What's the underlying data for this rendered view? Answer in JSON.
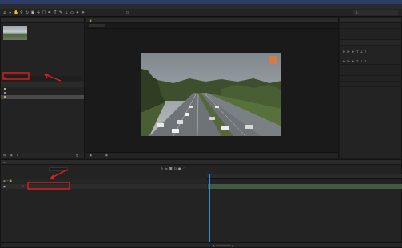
{
  "app": {
    "title": "",
    "menu": [
      "",
      "",
      "",
      "",
      "",
      "",
      "",
      "",
      ""
    ]
  },
  "toolbar": {
    "snapping_label": "",
    "search_label": "",
    "workspaces": [
      "",
      "",
      "",
      "",
      "",
      ""
    ]
  },
  "project": {
    "tab_label": "",
    "comp_tab_label": "",
    "thumb_name": "",
    "thumb_info": [
      "",
      ""
    ],
    "items": [
      "",
      "",
      ""
    ]
  },
  "viewer": {
    "tab_label": "",
    "zoom": "",
    "timecode": "",
    "quality": "",
    "camera": "",
    "views": ""
  },
  "right_panel": {
    "items": [
      "",
      "",
      "",
      "",
      "",
      "",
      "",
      "",
      "",
      "",
      "",
      ""
    ]
  },
  "timeline": {
    "tab_label": "",
    "timecode": "",
    "search_placeholder": "",
    "columns": [
      "",
      "",
      ""
    ],
    "layer_name": "",
    "layer_mode": "",
    "layer_parent": "",
    "ticks": [
      "",
      "",
      "",
      "",
      "",
      "",
      "",
      "",
      "",
      "",
      "",
      "",
      "",
      "",
      ""
    ]
  },
  "colors": {
    "accent": "#2d8ceb",
    "selection": "#4a4a4a",
    "annotation": "#e02020",
    "titlebar": "#2c3e68"
  }
}
